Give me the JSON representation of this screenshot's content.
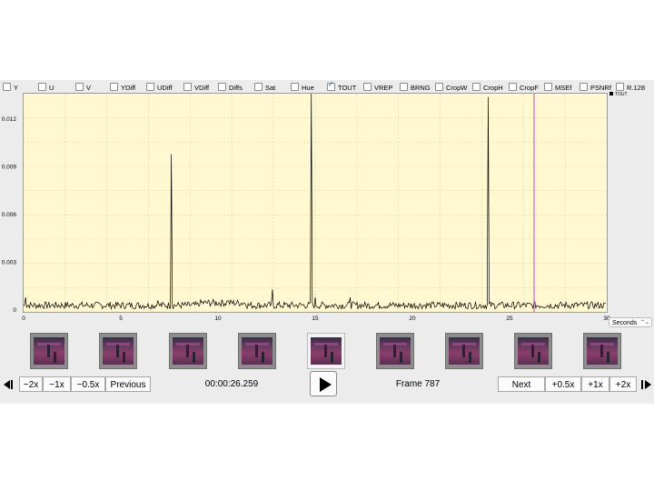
{
  "filters": [
    {
      "label": "Y",
      "checked": false
    },
    {
      "label": "U",
      "checked": false
    },
    {
      "label": "V",
      "checked": false
    },
    {
      "label": "YDiff",
      "checked": false
    },
    {
      "label": "UDiff",
      "checked": false
    },
    {
      "label": "VDiff",
      "checked": false
    },
    {
      "label": "Diffs",
      "checked": false
    },
    {
      "label": "Sat",
      "checked": false
    },
    {
      "label": "Hue",
      "checked": false
    },
    {
      "label": "TOUT",
      "checked": true
    },
    {
      "label": "VREP",
      "checked": false
    },
    {
      "label": "BRNG",
      "checked": false
    },
    {
      "label": "CropW",
      "checked": false
    },
    {
      "label": "CropH",
      "checked": false
    },
    {
      "label": "CropF",
      "checked": false
    },
    {
      "label": "MSEf",
      "checked": false
    },
    {
      "label": "PSNRf",
      "checked": false
    },
    {
      "label": "R.128",
      "checked": false
    }
  ],
  "chart_data": {
    "type": "line",
    "xlim": [
      0,
      30
    ],
    "ylim": [
      0,
      0.0135
    ],
    "x_ticks": [
      "0",
      "5",
      "10",
      "15",
      "20",
      "25",
      "30"
    ],
    "y_ticks": [
      "0",
      "0.003",
      "0.006",
      "0.009",
      "0.012"
    ],
    "grid": true,
    "legend": "top-right",
    "series": [
      {
        "name": "TOUT",
        "color": "#000000",
        "baseline": 0.0003,
        "spikes": [
          {
            "x": 0.1,
            "y": 0.0008
          },
          {
            "x": 6.9,
            "y": 0.0006
          },
          {
            "x": 7.6,
            "y": 0.0098
          },
          {
            "x": 10.5,
            "y": 0.0006
          },
          {
            "x": 12.8,
            "y": 0.0013
          },
          {
            "x": 14.8,
            "y": 0.0137
          },
          {
            "x": 15.0,
            "y": 0.0008
          },
          {
            "x": 16.8,
            "y": 0.0008
          },
          {
            "x": 23.9,
            "y": 0.0134
          }
        ]
      }
    ],
    "cursor_x": 26.26,
    "cursor_color": "#cc44cc"
  },
  "units_select": {
    "value": "Seconds"
  },
  "thumbnails": [
    {
      "selected": false
    },
    {
      "selected": false
    },
    {
      "selected": false
    },
    {
      "selected": false
    },
    {
      "selected": true
    },
    {
      "selected": false
    },
    {
      "selected": false
    },
    {
      "selected": false
    },
    {
      "selected": false
    }
  ],
  "controls": {
    "minus2x": "−2x",
    "minus1x": "−1x",
    "minus05x": "−0.5x",
    "previous": "Previous",
    "timestamp": "00:00:26.259",
    "frame": "Frame 787",
    "next": "Next",
    "plus05x": "+0.5x",
    "plus1x": "+1x",
    "plus2x": "+2x"
  }
}
